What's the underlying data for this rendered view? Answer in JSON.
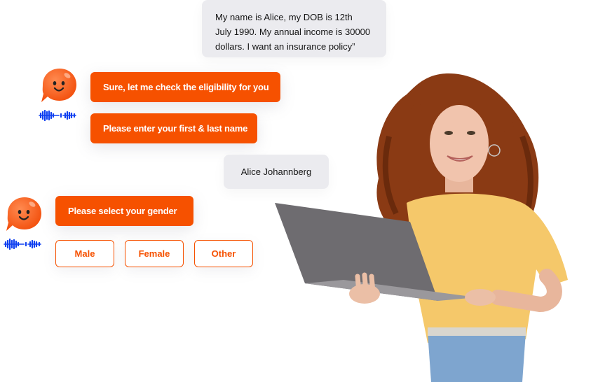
{
  "conversation": {
    "messages": [
      {
        "sender": "user",
        "text_lines": [
          "My name is Alice, my DOB is 12th",
          "July 1990. My annual income is 30000",
          "dollars. I want an insurance policy”"
        ]
      },
      {
        "sender": "bot",
        "text": "Sure, let me check the eligibility for you"
      },
      {
        "sender": "bot",
        "text": "Please enter your first & last name"
      },
      {
        "sender": "user",
        "text": "Alice Johannberg"
      },
      {
        "sender": "bot",
        "text": "Please select your gender"
      }
    ],
    "gender_options": [
      "Male",
      "Female",
      "Other"
    ]
  },
  "icons": {
    "bot_avatar": "smiling-chat-bubble-icon",
    "voice_wave": "sound-wave-icon"
  },
  "colors": {
    "brand_orange": "#f65100",
    "user_bubble": "#ebebef",
    "voice_blue": "#1040f0"
  },
  "illustration": {
    "subject": "woman with curly red hair holding a laptop"
  }
}
